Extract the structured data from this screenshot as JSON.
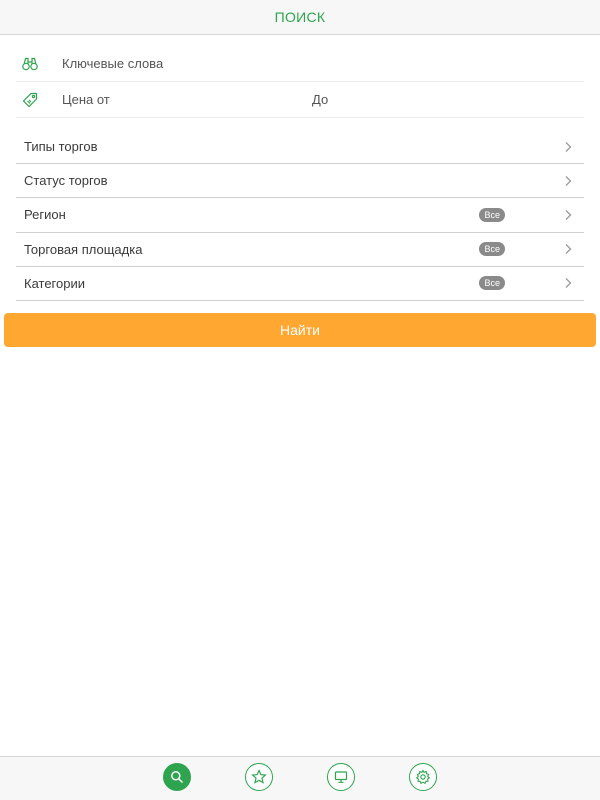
{
  "header": {
    "title": "ПОИСК"
  },
  "search": {
    "keywords_placeholder": "Ключевые слова",
    "keywords_value": "",
    "price_from_placeholder": "Цена от",
    "price_from_value": "",
    "price_to_placeholder": "До",
    "price_to_value": ""
  },
  "filters": [
    {
      "label": "Типы торгов",
      "badge": ""
    },
    {
      "label": "Статус торгов",
      "badge": ""
    },
    {
      "label": "Регион",
      "badge": "Все"
    },
    {
      "label": "Торговая площадка",
      "badge": "Все"
    },
    {
      "label": "Категории",
      "badge": "Все"
    }
  ],
  "actions": {
    "find_label": "Найти"
  },
  "tabbar": {
    "items": [
      {
        "icon": "search-icon",
        "active": true
      },
      {
        "icon": "star-icon",
        "active": false
      },
      {
        "icon": "monitor-icon",
        "active": false
      },
      {
        "icon": "gear-icon",
        "active": false
      }
    ]
  },
  "colors": {
    "accent_green": "#2ea44f",
    "button_orange": "#ffa730",
    "badge_gray": "#8a8a8a"
  }
}
